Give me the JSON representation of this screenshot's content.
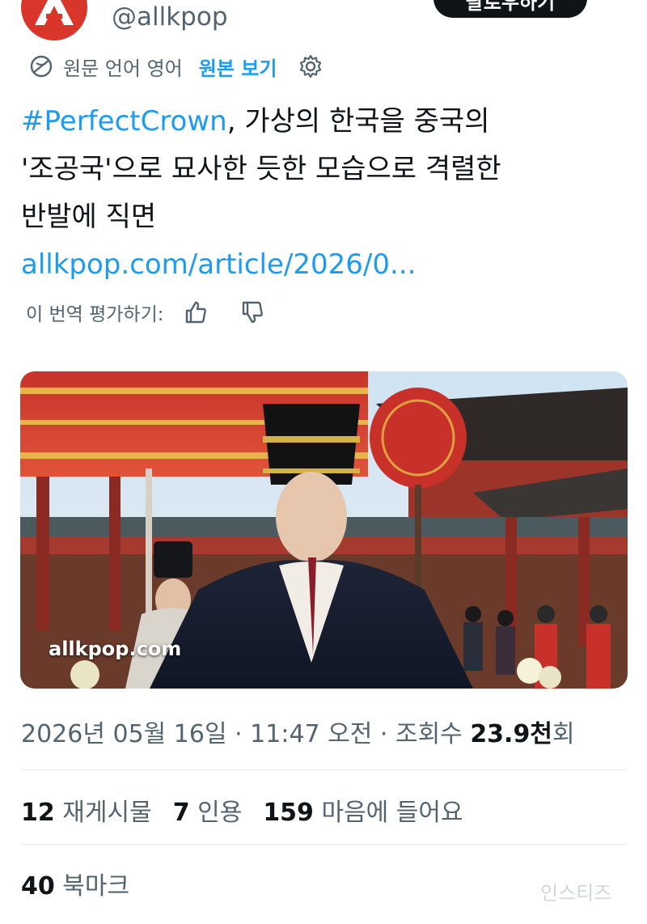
{
  "header": {
    "handle": "@allkpop",
    "follow_label": "팔로우하기",
    "avatar_icon": "allkpop-logo-icon"
  },
  "translation": {
    "label": "원문 언어 영어",
    "show_original": "원본 보기",
    "globe_icon": "globe-icon",
    "settings_icon": "gear-icon"
  },
  "tweet": {
    "hashtag": "#PerfectCrown",
    "line1_rest": ", 가상의 한국을 중국의",
    "line2": "'조공국'으로 묘사한 듯한 모습으로 격렬한",
    "line3": "반발에 직면",
    "link": "allkpop.com/article/2026/0..."
  },
  "rate": {
    "label": "이 번역 평가하기:",
    "up_icon": "thumbs-up-icon",
    "down_icon": "thumbs-down-icon"
  },
  "media": {
    "watermark": "allkpop.com"
  },
  "meta": {
    "timestamp": "2026년 05월 16일 · 11:47 오전 · 조회수 ",
    "views": "23.9천",
    "views_suffix": "회"
  },
  "stats": {
    "reposts_count": "12",
    "reposts_label": " 재게시물",
    "quotes_count": "7",
    "quotes_label": " 인용",
    "likes_count": "159",
    "likes_label": " 마음에 들어요",
    "bookmarks_count": "40",
    "bookmarks_label": " 북마크"
  },
  "site_watermark": "인스티즈",
  "colors": {
    "accent": "#1d9bf0",
    "text": "#0f1419",
    "muted": "#536471",
    "avatar": "#d9362b"
  }
}
